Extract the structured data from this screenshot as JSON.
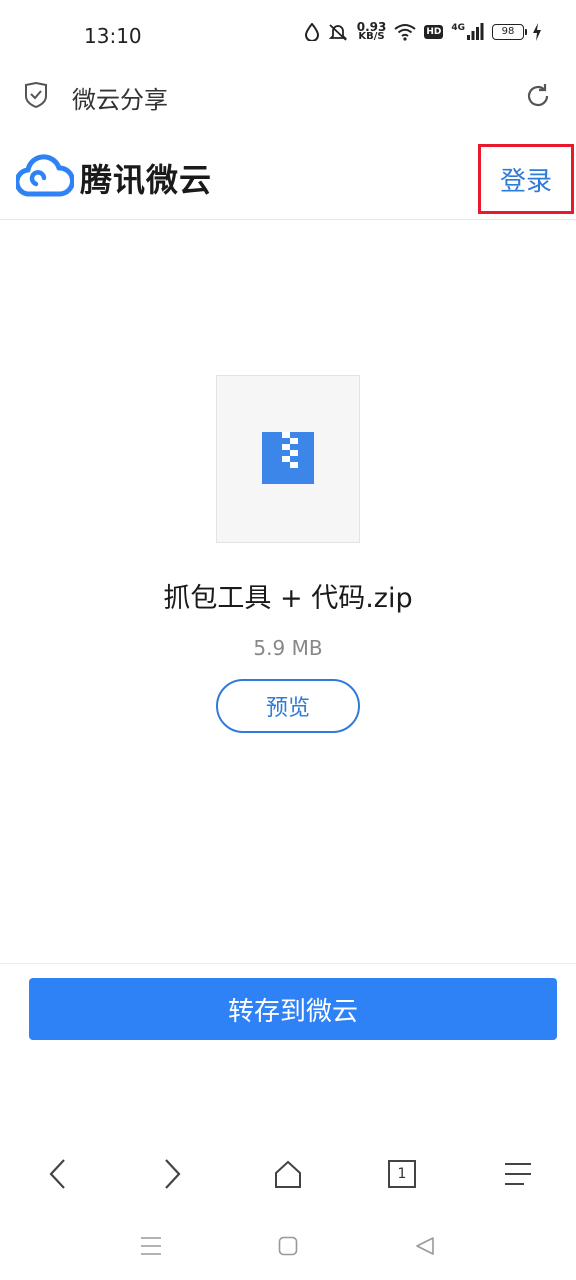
{
  "status_bar": {
    "time": "13:10",
    "net_speed_value": "0.93",
    "net_speed_unit": "KB/S",
    "hd": "HD",
    "signal_type": "4G",
    "battery": "98"
  },
  "browser_bar": {
    "title": "微云分享"
  },
  "site_header": {
    "brand": "腾讯微云",
    "login_label": "登录"
  },
  "file": {
    "name": "抓包工具 + 代码.zip",
    "size": "5.9 MB",
    "preview_label": "预览"
  },
  "save": {
    "label": "转存到微云"
  },
  "browser_nav": {
    "tab_count": "1"
  },
  "colors": {
    "accent": "#2f82f5",
    "link": "#2f7bd8",
    "highlight_border": "#e8192c"
  }
}
